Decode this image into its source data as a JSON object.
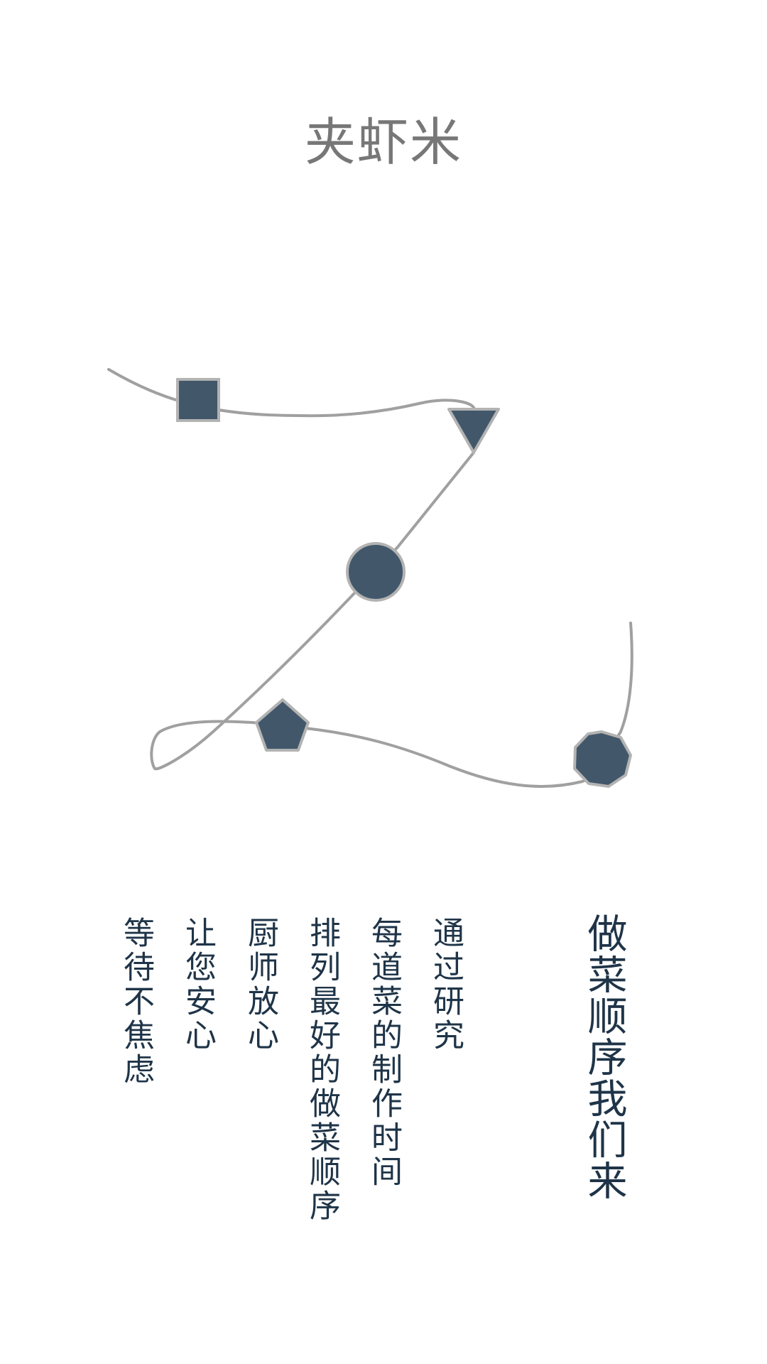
{
  "app": {
    "title": "夹虾米"
  },
  "illustration": {
    "shape_fill": "#42576a",
    "shape_stroke": "#b3b3b3",
    "path_color": "#a0a0a0",
    "shapes": [
      "square",
      "triangle",
      "circle",
      "pentagon",
      "heptagon"
    ]
  },
  "intro": {
    "heading": "做菜顺序我们来",
    "lines": [
      "通过研究",
      "每道菜的制作时间",
      "排列最好的做菜顺序",
      "厨师放心",
      "让您安心",
      "等待不焦虑"
    ]
  }
}
